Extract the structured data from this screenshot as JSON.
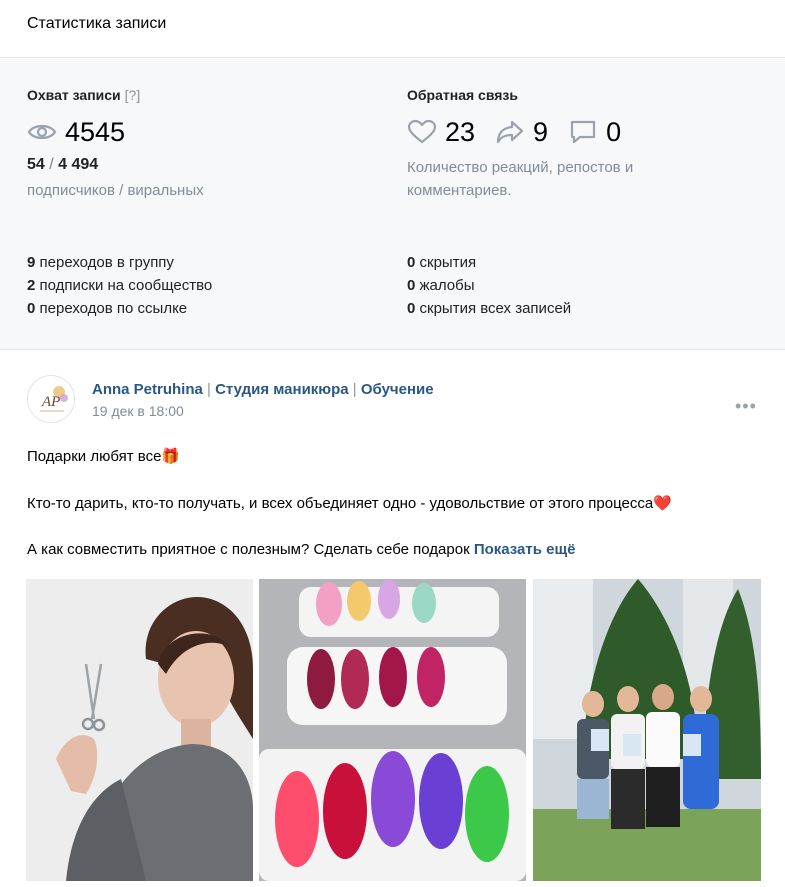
{
  "header": {
    "title": "Статистика записи"
  },
  "reach": {
    "title": "Охват записи",
    "help": "[?]",
    "total": "4545",
    "subscribers": "54",
    "slash": " / ",
    "viral": "4 494",
    "caption": "подписчиков / виральных"
  },
  "feedback": {
    "title": "Обратная связь",
    "likes": "23",
    "reposts": "9",
    "comments": "0",
    "caption_line1": "Количество реакций, репостов и",
    "caption_line2": "комментариев."
  },
  "actions_left": [
    {
      "num": "9",
      "text": " переходов в группу"
    },
    {
      "num": "2",
      "text": " подписки на сообщество"
    },
    {
      "num": "0",
      "text": " переходов по ссылке"
    }
  ],
  "actions_right": [
    {
      "num": "0",
      "text": " скрытия"
    },
    {
      "num": "0",
      "text": " жалобы"
    },
    {
      "num": "0",
      "text": " скрытия всех записей"
    }
  ],
  "post": {
    "author_part1": "Anna Petruhina",
    "sep": " | ",
    "author_part2": "Студия маникюра",
    "author_part3": "Обучение",
    "date": "19 дек в 18:00",
    "more_label": "•••",
    "text_line1": "Подарки любят все🎁",
    "text_line2": "Кто-то дарить, кто-то получать, и всех объединяет одно - удовольствие от этого процесса❤️",
    "text_line3": "А как совместить приятное с полезным? Сделать себе подарок",
    "show_more": "Показать ещё",
    "avatar_logo": "AP"
  },
  "icons": {
    "views": "eye-icon",
    "likes": "heart-icon",
    "reposts": "share-arrow-icon",
    "comments": "comment-icon"
  },
  "colors": {
    "link": "#2a5885",
    "muted": "#818c99",
    "icon": "#99a2ad"
  }
}
